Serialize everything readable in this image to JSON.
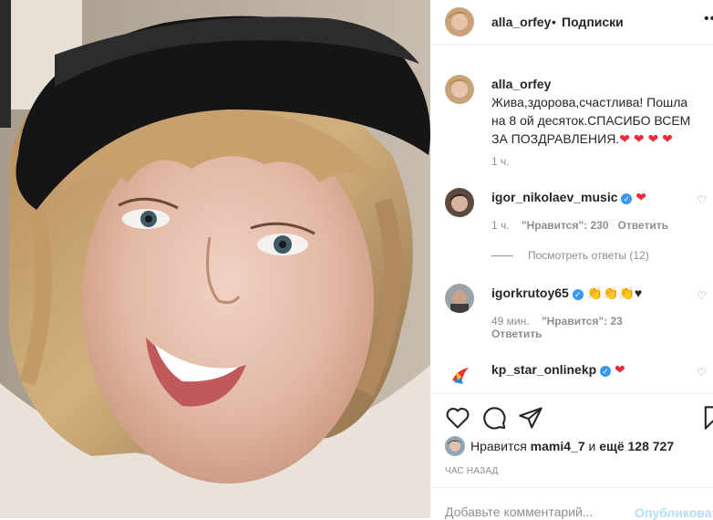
{
  "header": {
    "username": "alla_orfey",
    "separator": "•",
    "follow_label": "Подписки",
    "more_label": "•••"
  },
  "caption": {
    "username": "alla_orfey",
    "text": "Жива,здорова,счастлива! Пошла на 8 ой десяток.СПАСИБО ВСЕМ ЗА ПОЗДРАВЛЕНИЯ.",
    "hearts": "❤ ❤ ❤ ❤",
    "time": "1 ч."
  },
  "comments": [
    {
      "username": "igor_nikolaev_music",
      "text": "❤",
      "time": "1 ч.",
      "likes": "\"Нравится\": 230",
      "reply": "Ответить",
      "view_replies": "Посмотреть ответы (12)"
    },
    {
      "username": "igorkrutoy65",
      "text": "👏👏👏♥",
      "time": "49 мин.",
      "likes": "\"Нравится\": 23",
      "reply": "Ответить"
    },
    {
      "username": "kp_star_onlinekp",
      "text": "❤"
    }
  ],
  "actions": {
    "icons": [
      "heart-outline-icon",
      "comment-icon",
      "share-icon",
      "bookmark-icon"
    ]
  },
  "likes": {
    "prefix": "Нравится",
    "user": "mami4_7",
    "middle": "и",
    "others": "ещё 128 727"
  },
  "post_time": "ЧАС НАЗАД",
  "add_comment": {
    "placeholder": "Добавьте комментарий...",
    "post_label": "Опубликовать"
  },
  "colors": {
    "heart": "#ed2a3c",
    "verified": "#3897f0",
    "post_disabled": "#b2dffc"
  }
}
